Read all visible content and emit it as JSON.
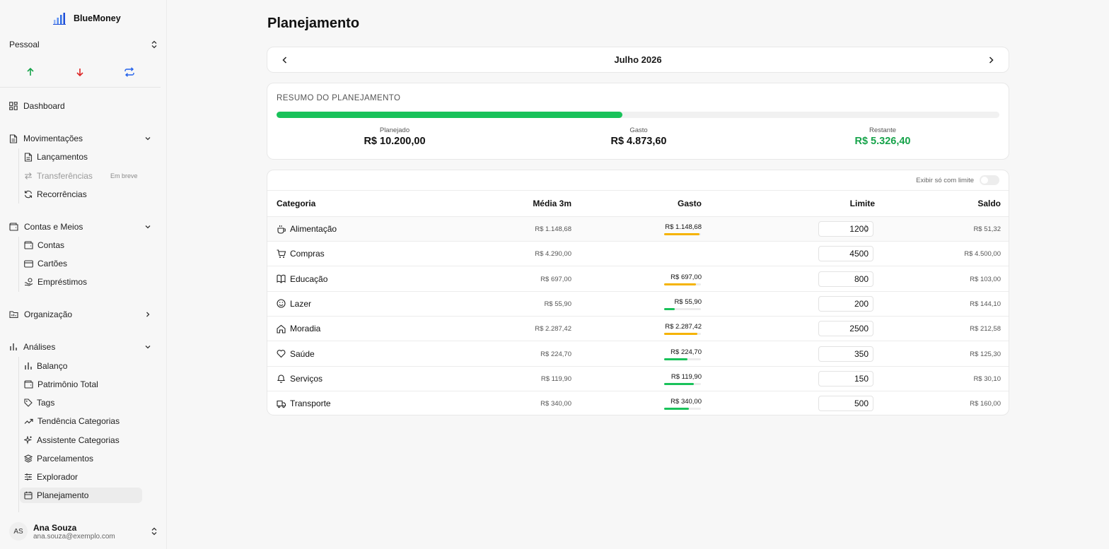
{
  "brand": {
    "name": "BlueMoney",
    "logo_icon": "bar-chart-logo-icon",
    "accent": "#2563eb"
  },
  "profile": {
    "name": "Pessoal"
  },
  "quick_actions": [
    {
      "icon": "arrow-up-icon",
      "color": "#16a34a"
    },
    {
      "icon": "arrow-down-icon",
      "color": "#dc2626"
    },
    {
      "icon": "repeat-icon",
      "color": "#2563eb"
    }
  ],
  "nav": {
    "dashboard": "Dashboard",
    "movimentacoes": {
      "label": "Movimentações",
      "items": [
        "Lançamentos",
        "Transferências",
        "Recorrências"
      ],
      "soon": "Em breve"
    },
    "contas": {
      "label": "Contas e Meios",
      "items": [
        "Contas",
        "Cartões",
        "Empréstimos"
      ]
    },
    "organizacao": "Organização",
    "analises": {
      "label": "Análises",
      "items": [
        "Balanço",
        "Patrimônio Total",
        "Tags",
        "Tendência Categorias",
        "Assistente Categorias",
        "Parcelamentos",
        "Explorador",
        "Planejamento"
      ]
    }
  },
  "user": {
    "initials": "AS",
    "name": "Ana Souza",
    "email": "ana.souza@exemplo.com"
  },
  "page": {
    "title": "Planejamento",
    "month": "Julho 2026"
  },
  "summary": {
    "title": "RESUMO DO PLANEJAMENTO",
    "progress": 0.478,
    "planned_label": "Planejado",
    "planned_value": "R$ 10.200,00",
    "spent_label": "Gasto",
    "spent_value": "R$ 4.873,60",
    "remaining_label": "Restante",
    "remaining_value": "R$ 5.326,40"
  },
  "table": {
    "toggle_label": "Exibir só com limite",
    "headers": {
      "category": "Categoria",
      "avg": "Média 3m",
      "spent": "Gasto",
      "limit": "Limite",
      "balance": "Saldo"
    },
    "rows": [
      {
        "icon": "coffee-icon",
        "name": "Alimentação",
        "avg": "R$ 1.148,68",
        "spent": "R$ 1.148,68",
        "ratio": 0.96,
        "bar_color": "#f5b300",
        "limit": "1200",
        "balance": "R$ 51,32"
      },
      {
        "icon": "cart-icon",
        "name": "Compras",
        "avg": "R$ 4.290,00",
        "spent": "",
        "ratio": 0,
        "bar_color": "#19c25a",
        "limit": "4500",
        "balance": "R$ 4.500,00"
      },
      {
        "icon": "book-icon",
        "name": "Educação",
        "avg": "R$ 697,00",
        "spent": "R$ 697,00",
        "ratio": 0.87,
        "bar_color": "#f5b300",
        "limit": "800",
        "balance": "R$ 103,00"
      },
      {
        "icon": "smile-icon",
        "name": "Lazer",
        "avg": "R$ 55,90",
        "spent": "R$ 55,90",
        "ratio": 0.28,
        "bar_color": "#19c25a",
        "limit": "200",
        "balance": "R$ 144,10"
      },
      {
        "icon": "home-icon",
        "name": "Moradia",
        "avg": "R$ 2.287,42",
        "spent": "R$ 2.287,42",
        "ratio": 0.91,
        "bar_color": "#f5b300",
        "limit": "2500",
        "balance": "R$ 212,58"
      },
      {
        "icon": "heart-icon",
        "name": "Saúde",
        "avg": "R$ 224,70",
        "spent": "R$ 224,70",
        "ratio": 0.64,
        "bar_color": "#19c25a",
        "limit": "350",
        "balance": "R$ 125,30"
      },
      {
        "icon": "bell-icon",
        "name": "Serviços",
        "avg": "R$ 119,90",
        "spent": "R$ 119,90",
        "ratio": 0.8,
        "bar_color": "#19c25a",
        "limit": "150",
        "balance": "R$ 30,10"
      },
      {
        "icon": "truck-icon",
        "name": "Transporte",
        "avg": "R$ 340,00",
        "spent": "R$ 340,00",
        "ratio": 0.68,
        "bar_color": "#19c25a",
        "limit": "500",
        "balance": "R$ 160,00"
      }
    ]
  }
}
